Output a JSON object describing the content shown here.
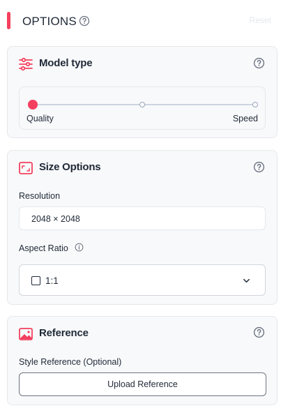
{
  "header": {
    "title": "OPTIONS",
    "faint_action": "Reset"
  },
  "colors": {
    "accent": "#f43f5e",
    "card_bg": "#f8f9fa",
    "border": "#e5e7eb"
  },
  "model_type": {
    "title": "Model type",
    "icon": "sliders-icon",
    "slider": {
      "min_label": "Quality",
      "max_label": "Speed",
      "stops": 3,
      "selected_index": 0
    }
  },
  "size_options": {
    "title": "Size Options",
    "icon": "resize-frame-icon",
    "resolution_label": "Resolution",
    "resolution_value": "2048 × 2048",
    "aspect_ratio_label": "Aspect Ratio",
    "aspect_ratio_value": "1:1"
  },
  "reference": {
    "title": "Reference",
    "icon": "image-icon",
    "style_reference_label": "Style Reference (Optional)",
    "upload_button_label": "Upload Reference"
  }
}
